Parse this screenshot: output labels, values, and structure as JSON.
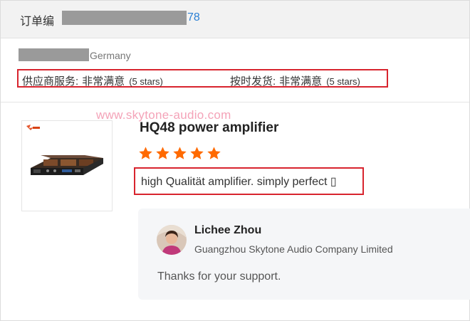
{
  "order": {
    "label": "订单编",
    "number_suffix": "78"
  },
  "buyer": {
    "country": "Germany"
  },
  "ratings": [
    {
      "label": "供应商服务:",
      "value": "非常满意",
      "stars_text": "(5 stars)"
    },
    {
      "label": "按时发货:",
      "value": "非常满意",
      "stars_text": "(5 stars)"
    }
  ],
  "watermark": "www.skytone-audio.com",
  "product": {
    "title": "HQ48 power amplifier",
    "rating": 5,
    "review": "high Qualität amplifier. simply perfect ▯"
  },
  "reply": {
    "name": "Lichee Zhou",
    "company": "Guangzhou Skytone Audio Company Limited",
    "text": "Thanks for your support."
  },
  "colors": {
    "star": "#ff6a00",
    "highlight_border": "#d8242e",
    "link": "#2a7fd4"
  },
  "icons": {
    "star": "star-icon",
    "avatar": "avatar"
  }
}
